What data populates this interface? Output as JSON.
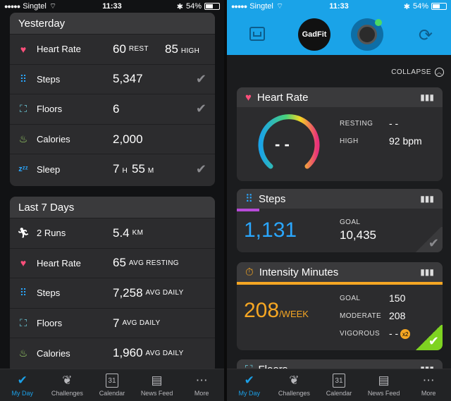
{
  "status_left": {
    "signal": "●●●●●",
    "carrier": "Singtel",
    "time": "11:33",
    "battery": "54%",
    "battery_fraction": 0.54
  },
  "status_right": {
    "signal": "●●●●●",
    "carrier": "Singtel",
    "time": "11:33",
    "battery": "54%",
    "battery_fraction": 0.54
  },
  "yesterday": {
    "title": "Yesterday",
    "heart_rate": {
      "label": "Heart Rate",
      "value": "60",
      "unit": "REST",
      "value2": "85",
      "unit2": "HIGH"
    },
    "steps": {
      "label": "Steps",
      "value": "5,347"
    },
    "floors": {
      "label": "Floors",
      "value": "6"
    },
    "calories": {
      "label": "Calories",
      "value": "2,000"
    },
    "sleep": {
      "label": "Sleep",
      "hours": "7",
      "h_unit": "H",
      "minutes": "55",
      "m_unit": "M"
    }
  },
  "last7": {
    "title": "Last 7 Days",
    "runs": {
      "label": "2 Runs",
      "value": "5.4",
      "unit": "KM"
    },
    "heart_rate": {
      "label": "Heart Rate",
      "value": "65",
      "unit": "AVG RESTING"
    },
    "steps": {
      "label": "Steps",
      "value": "7,258",
      "unit": "AVG DAILY"
    },
    "floors": {
      "label": "Floors",
      "value": "7",
      "unit": "AVG DAILY"
    },
    "calories": {
      "label": "Calories",
      "value": "1,960",
      "unit": "AVG DAILY"
    }
  },
  "tabs": [
    {
      "label": "My Day",
      "icon": "check-icon"
    },
    {
      "label": "Challenges",
      "icon": "laurel-icon"
    },
    {
      "label": "Calendar",
      "icon": "calendar-icon",
      "day": "31"
    },
    {
      "label": "News Feed",
      "icon": "newspaper-icon"
    },
    {
      "label": "More",
      "icon": "more-icon"
    }
  ],
  "right": {
    "gadfit_label": "GadFit",
    "collapse_label": "COLLAPSE",
    "heart": {
      "title": "Heart Rate",
      "gauge_value": "- -",
      "resting_label": "RESTING",
      "resting_value": "- -",
      "high_label": "HIGH",
      "high_value": "92 bpm"
    },
    "steps": {
      "title": "Steps",
      "value": "1,131",
      "goal_label": "GOAL",
      "goal_value": "10,435"
    },
    "intensity": {
      "title": "Intensity Minutes",
      "value": "208",
      "unit": "/WEEK",
      "goal_label": "GOAL",
      "goal_value": "150",
      "moderate_label": "MODERATE",
      "moderate_value": "208",
      "vigorous_label": "VIGOROUS",
      "vigorous_value": "- -",
      "badge": "x2"
    },
    "floors": {
      "title": "Floors"
    }
  },
  "colors": {
    "accent_blue": "#1ba0e8",
    "steps_blue": "#2aa7ff",
    "intensity_orange": "#f5a623",
    "heart_pink": "#ff4f7b",
    "green": "#7ed321",
    "steps_bar": "#b84ad8"
  }
}
